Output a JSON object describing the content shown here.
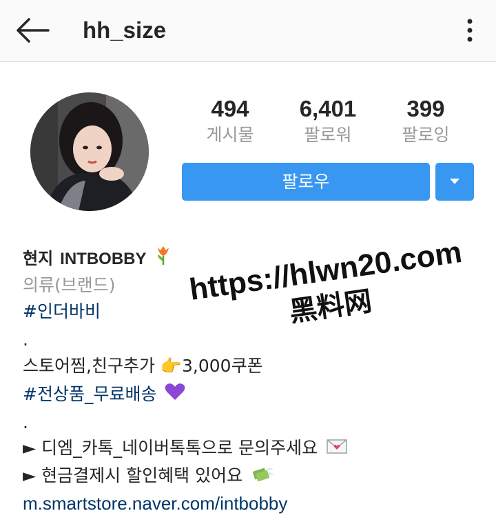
{
  "header": {
    "username": "hh_size",
    "back_icon": "arrow-left-icon",
    "menu_icon": "kebab-menu-icon"
  },
  "profile": {
    "avatar_icon": "profile-photo"
  },
  "stats": [
    {
      "count": "494",
      "label": "게시물"
    },
    {
      "count": "6,401",
      "label": "팔로워"
    },
    {
      "count": "399",
      "label": "팔로잉"
    }
  ],
  "actions": {
    "follow_label": "팔로우",
    "dropdown_icon": "caret-down-icon",
    "accent_color": "#3897f0"
  },
  "bio": {
    "name": "현지",
    "brand": "INTBOBBY",
    "category": "의류(브랜드)",
    "hashtag1": "#인더바비",
    "dot1": ".",
    "line_store": "스토어찜,친구추가 👉3,000쿠폰",
    "hashtag2": "#전상품_무료배송",
    "dot2": ".",
    "line_contact": "► 디엠_카톡_네이버톡톡으로 문의주세요",
    "line_discount": "► 현금결제시 할인혜택 있어요",
    "link": "m.smartstore.naver.com/intbobby",
    "link_color": "#003569"
  },
  "watermark": {
    "line1": "https://hlwn20.com",
    "line2": "黑料网"
  }
}
